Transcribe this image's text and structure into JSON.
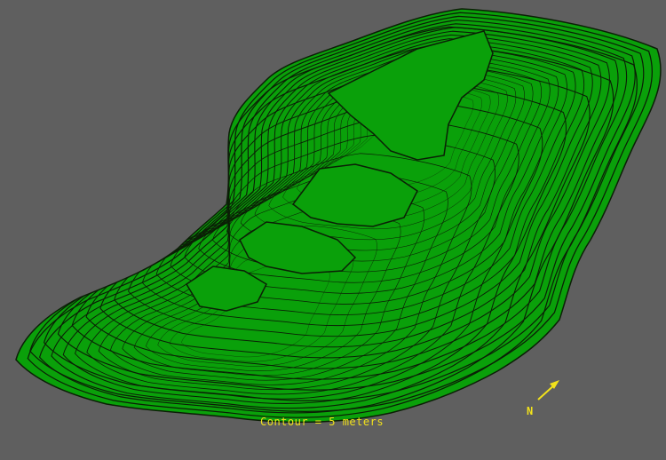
{
  "map": {
    "background_color": "#5f5f5f",
    "terrain_color": "#0aa00a",
    "contour_color": "#0b1f06",
    "label_color": "#f2e21b",
    "contour_legend": "Contour = 5 meters",
    "north_label": "N"
  }
}
